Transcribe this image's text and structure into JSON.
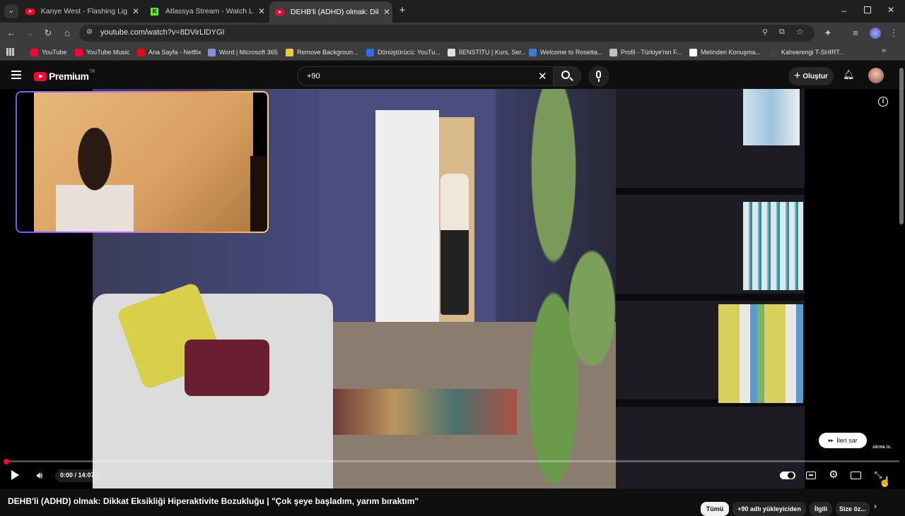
{
  "browser": {
    "tabs": [
      {
        "title": "Kanye West - Flashing Lights ft.",
        "favicon": "youtube-icon",
        "active": false
      },
      {
        "title": "Atlassya Stream - Watch Live or",
        "favicon": "kick-icon",
        "active": false
      },
      {
        "title": "DEHB'li (ADHD) olmak: Dikkat E",
        "favicon": "youtube-icon",
        "active": true
      }
    ],
    "url": "youtube.com/watch?v=8DVirLlDYGI",
    "bookmarks": [
      {
        "label": "YouTube",
        "color": "#ff0033"
      },
      {
        "label": "YouTube Music",
        "color": "#ff0033"
      },
      {
        "label": "Ana Sayfa - Netflix",
        "color": "#e50914"
      },
      {
        "label": "Word | Microsoft 365",
        "color": "#8a8fd8"
      },
      {
        "label": "Remove Backgroun...",
        "color": "#f2c744"
      },
      {
        "label": "Dönüştürücü: YouTu...",
        "color": "#2d6be0"
      },
      {
        "label": "İIENSTITU | Kurs, Ser...",
        "color": "#e0e0e0"
      },
      {
        "label": "Welcome to Rosetta...",
        "color": "#3a7bd5"
      },
      {
        "label": "Profil - Türkiye'nin F...",
        "color": "#c0c0c0"
      },
      {
        "label": "Metinden Konuşma...",
        "color": "#ffffff"
      },
      {
        "label": "Kahverengi T-SHIRT...",
        "color": "#444"
      }
    ]
  },
  "youtube": {
    "logo_text": "Premium",
    "logo_badge": "TR",
    "search_value": "+90",
    "create_label": "Oluştur",
    "accent": "#ff0033"
  },
  "player": {
    "time": "0:00 / 14:07",
    "skip_label": "İleri sar",
    "subscribe_watermark": "ABONE OL",
    "progress": 0.0
  },
  "video_title": "DEHB'li (ADHD) olmak: Dikkat Eksikliği Hiperaktivite Bozukluğu | \"Çok şeye başladım, yarım bıraktım\"",
  "chips": [
    "Tümü",
    "+90 adlı yükleyiciden",
    "İlgili",
    "Size öz..."
  ]
}
